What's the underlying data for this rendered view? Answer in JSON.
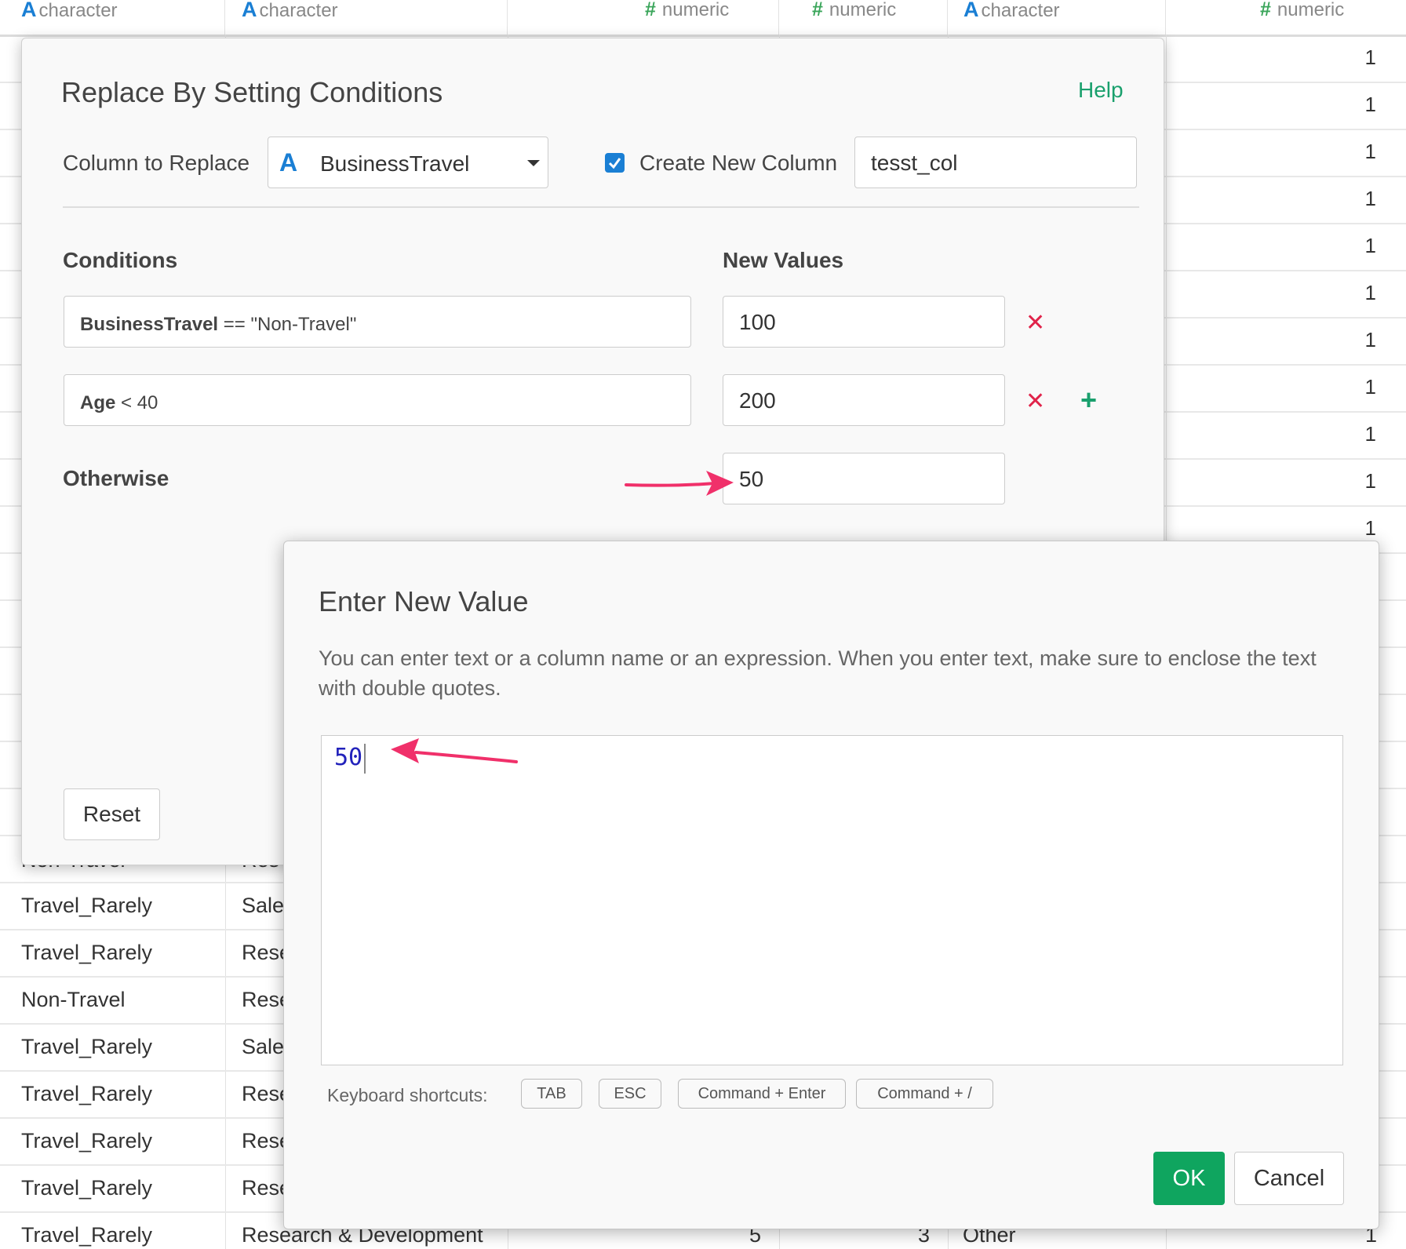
{
  "table": {
    "headers": [
      {
        "type": "character",
        "icon": "character-type-icon"
      },
      {
        "type": "character",
        "icon": "character-type-icon"
      },
      {
        "type": "numeric",
        "icon": "numeric-type-icon"
      },
      {
        "type": "numeric",
        "icon": "numeric-type-icon"
      },
      {
        "type": "character",
        "icon": "character-type-icon"
      },
      {
        "type": "numeric",
        "icon": "numeric-type-icon"
      }
    ],
    "last_col_values": [
      "1",
      "1",
      "1",
      "1",
      "1",
      "1",
      "1",
      "1",
      "1",
      "1",
      "1"
    ],
    "rows": [
      {
        "c1": "Non-Travel",
        "c2": "Res"
      },
      {
        "c1": "Travel_Rarely",
        "c2": "Sale"
      },
      {
        "c1": "Travel_Rarely",
        "c2": "Rese"
      },
      {
        "c1": "Non-Travel",
        "c2": "Rese"
      },
      {
        "c1": "Travel_Rarely",
        "c2": "Sale"
      },
      {
        "c1": "Travel_Rarely",
        "c2": "Rese"
      },
      {
        "c1": "Travel_Rarely",
        "c2": "Rese"
      },
      {
        "c1": "Travel_Rarely",
        "c2": "Rese"
      },
      {
        "c1": "Travel_Rarely",
        "c2": "Research & Development",
        "c3": "5",
        "c4": "3",
        "c5": "Other",
        "c6": "1"
      }
    ]
  },
  "replace_dialog": {
    "title": "Replace By Setting Conditions",
    "help": "Help",
    "column_to_replace_label": "Column to Replace",
    "column_value": "BusinessTravel",
    "create_new_column_label": "Create New Column",
    "create_new_column_checked": true,
    "new_column_name": "tesst_col",
    "conditions_label": "Conditions",
    "new_values_label": "New Values",
    "conditions": [
      {
        "column": "BusinessTravel",
        "operator": "==",
        "value": "\"Non-Travel\"",
        "new_value": "100"
      },
      {
        "column": "Age",
        "operator": "<",
        "value": "40",
        "new_value": "200"
      }
    ],
    "otherwise_label": "Otherwise",
    "otherwise_value": "50",
    "reset": "Reset"
  },
  "value_dialog": {
    "title": "Enter New Value",
    "description": "You can enter text or a column name or an expression. When you enter text, make sure to enclose the text with double quotes.",
    "editor_value": "50",
    "shortcuts_label": "Keyboard shortcuts:",
    "shortcuts": [
      "TAB",
      "ESC",
      "Command + Enter",
      "Command + /"
    ],
    "ok": "OK",
    "cancel": "Cancel"
  },
  "colors": {
    "accent_green": "#0fa55f",
    "type_blue": "#1a7fd4",
    "delete_red": "#e0234a",
    "annotation_arrow": "#f0306a"
  }
}
